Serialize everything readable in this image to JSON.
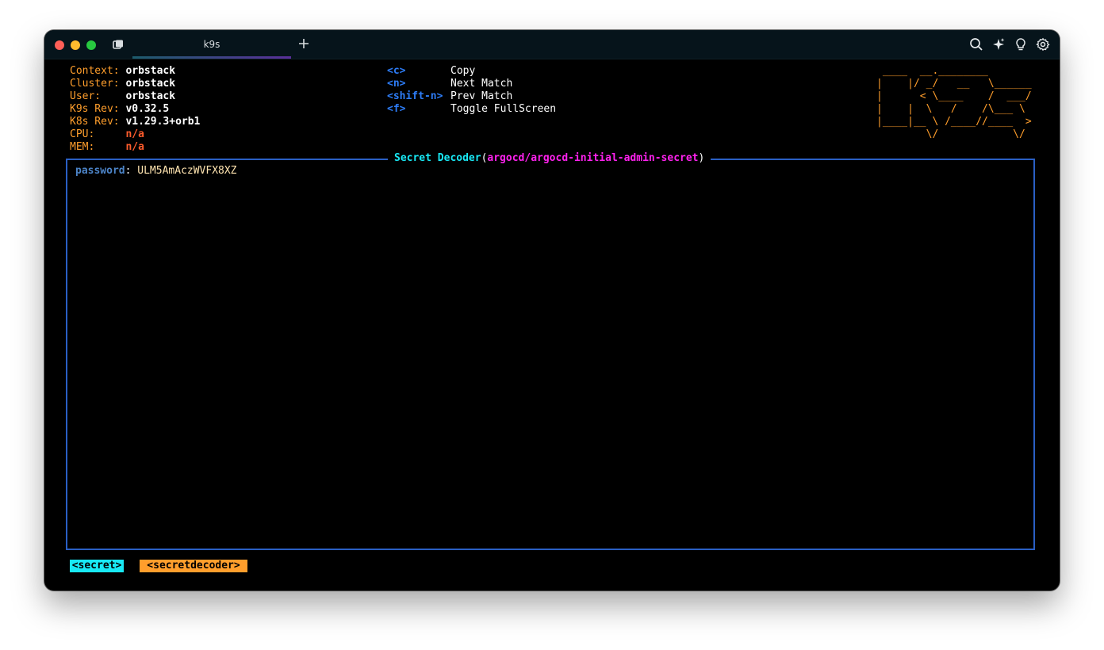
{
  "window": {
    "tab_title": "k9s"
  },
  "info": [
    {
      "label": "Context:",
      "value": "orbstack",
      "value_color": "white"
    },
    {
      "label": "Cluster:",
      "value": "orbstack",
      "value_color": "white"
    },
    {
      "label": "User:",
      "value": "orbstack",
      "value_color": "white"
    },
    {
      "label": "K9s Rev:",
      "value": "v0.32.5",
      "value_color": "white"
    },
    {
      "label": "K8s Rev:",
      "value": "v1.29.3+orb1",
      "value_color": "white"
    },
    {
      "label": "CPU:",
      "value": "n/a",
      "value_color": "red"
    },
    {
      "label": "MEM:",
      "value": "n/a",
      "value_color": "red"
    }
  ],
  "shortcuts": [
    {
      "key": "<c>",
      "desc": "Copy"
    },
    {
      "key": "<n>",
      "desc": "Next Match"
    },
    {
      "key": "<shift-n>",
      "desc": "Prev Match"
    },
    {
      "key": "<f>",
      "desc": "Toggle FullScreen"
    }
  ],
  "logo": " ____  __.________       \n|    |/ _/   __   \\______\n|      < \\____    /  ___/\n|    |  \\   /    /\\___ \\ \n|____|__ \\ /____//____  >\n        \\/            \\/ ",
  "panel": {
    "title": "Secret Decoder",
    "open_paren": "(",
    "resource": "argocd/argocd-initial-admin-secret",
    "close_paren": ")"
  },
  "secret": {
    "key": "password",
    "separator": ":",
    "value": "ULM5AmAczWVFX8XZ"
  },
  "breadcrumbs": [
    "<secret>",
    "<secretdecoder>"
  ],
  "colors": {
    "label": "#ff9e2c",
    "shortcut_key": "#2d7cf6",
    "panel_border": "#2a5fc4",
    "panel_title": "#18e9f5",
    "resource": "#ff22ee",
    "crumb_secret": "#18e9f5",
    "crumb_decoder": "#ff9e2c"
  }
}
